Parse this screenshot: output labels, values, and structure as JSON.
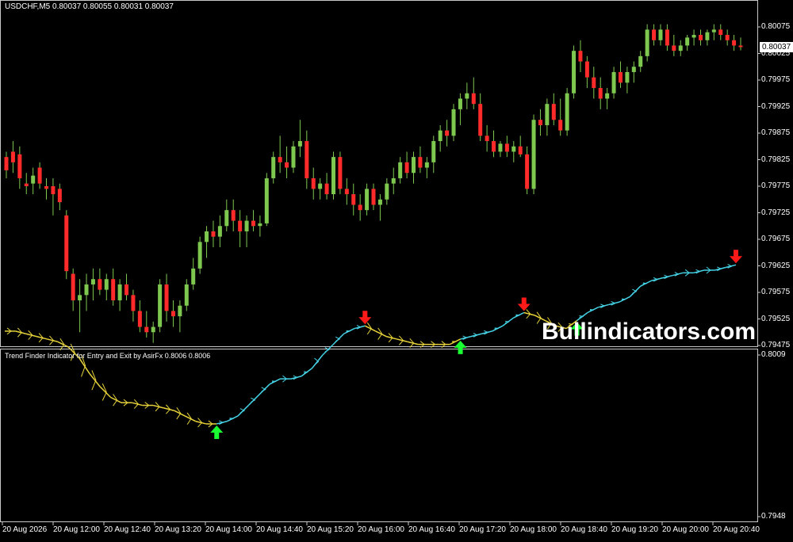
{
  "window": {
    "symbol_header": "USDCHF,M5  0.80037 0.80055 0.80031 0.80037",
    "indicator_header": "Trend Finder Indicator for Entry and Exit by AsirFx 0.8006 0.8006",
    "current_price": "0.80037",
    "watermark": "Bullindicators.com"
  },
  "colors": {
    "background": "#000000",
    "bull_candle": "#7ec850",
    "bear_candle": "#ff2a2a",
    "wick": "#7ec850",
    "uptrend": "#45d3e6",
    "downtrend": "#e6d23a",
    "buy_arrow": "#19ff32",
    "sell_arrow": "#ff1a1a"
  },
  "price_axis": [
    "0.80075",
    "0.80025",
    "0.79975",
    "0.79925",
    "0.79875",
    "0.79825",
    "0.79775",
    "0.79725",
    "0.79675",
    "0.79625",
    "0.79575",
    "0.79525",
    "0.79475"
  ],
  "indicator_axis": [
    "0.8009",
    "0.7948"
  ],
  "time_axis": [
    "20 Aug 2026",
    "20 Aug 12:00",
    "20 Aug 12:40",
    "20 Aug 13:20",
    "20 Aug 14:00",
    "20 Aug 14:40",
    "20 Aug 15:20",
    "20 Aug 16:00",
    "20 Aug 16:40",
    "20 Aug 17:20",
    "20 Aug 18:00",
    "20 Aug 18:40",
    "20 Aug 19:20",
    "20 Aug 20:00",
    "20 Aug 20:40"
  ],
  "chart_data": [
    {
      "type": "candlestick",
      "ylim": [
        0.79475,
        0.80075
      ],
      "candles": [
        [
          0.7983,
          0.7984,
          0.7979,
          0.79805
        ],
        [
          0.7984,
          0.7986,
          0.798,
          0.7982
        ],
        [
          0.79835,
          0.7985,
          0.7977,
          0.7979
        ],
        [
          0.7978,
          0.798,
          0.7976,
          0.79775
        ],
        [
          0.7978,
          0.7981,
          0.7976,
          0.79795
        ],
        [
          0.7981,
          0.7982,
          0.7977,
          0.7978
        ],
        [
          0.79775,
          0.7979,
          0.7975,
          0.7977
        ],
        [
          0.79775,
          0.7979,
          0.7972,
          0.7976
        ],
        [
          0.7977,
          0.7978,
          0.7973,
          0.79745
        ],
        [
          0.7972,
          0.7973,
          0.796,
          0.79615
        ],
        [
          0.7961,
          0.7962,
          0.7954,
          0.7956
        ],
        [
          0.7956,
          0.796,
          0.795,
          0.7957
        ],
        [
          0.7957,
          0.7961,
          0.7954,
          0.7959
        ],
        [
          0.7959,
          0.7962,
          0.7956,
          0.796
        ],
        [
          0.796,
          0.7962,
          0.7957,
          0.7958
        ],
        [
          0.7958,
          0.7961,
          0.7956,
          0.796
        ],
        [
          0.796,
          0.7962,
          0.7955,
          0.7956
        ],
        [
          0.7956,
          0.796,
          0.7954,
          0.7959
        ],
        [
          0.7959,
          0.7961,
          0.7956,
          0.7957
        ],
        [
          0.7957,
          0.7958,
          0.7952,
          0.7954
        ],
        [
          0.7954,
          0.7956,
          0.795,
          0.7951
        ],
        [
          0.7951,
          0.7954,
          0.7949,
          0.795
        ],
        [
          0.795,
          0.7952,
          0.7948,
          0.7951
        ],
        [
          0.7951,
          0.796,
          0.795,
          0.7959
        ],
        [
          0.7959,
          0.7961,
          0.7952,
          0.7954
        ],
        [
          0.7954,
          0.7956,
          0.7951,
          0.7953
        ],
        [
          0.7953,
          0.7956,
          0.795,
          0.7955
        ],
        [
          0.7955,
          0.796,
          0.7954,
          0.7959
        ],
        [
          0.7959,
          0.7964,
          0.7958,
          0.7962
        ],
        [
          0.7962,
          0.7968,
          0.7961,
          0.7967
        ],
        [
          0.7967,
          0.797,
          0.7964,
          0.7969
        ],
        [
          0.7969,
          0.7971,
          0.7966,
          0.7968
        ],
        [
          0.7968,
          0.7972,
          0.7966,
          0.797
        ],
        [
          0.797,
          0.7975,
          0.7969,
          0.7973
        ],
        [
          0.7973,
          0.7975,
          0.7969,
          0.7971
        ],
        [
          0.7971,
          0.7973,
          0.7966,
          0.7969
        ],
        [
          0.7969,
          0.7972,
          0.7966,
          0.7971
        ],
        [
          0.7971,
          0.7973,
          0.7969,
          0.797
        ],
        [
          0.797,
          0.7972,
          0.7968,
          0.79705
        ],
        [
          0.79705,
          0.798,
          0.797,
          0.7979
        ],
        [
          0.7979,
          0.7984,
          0.7978,
          0.7983
        ],
        [
          0.7983,
          0.7987,
          0.798,
          0.7982
        ],
        [
          0.7982,
          0.7985,
          0.7979,
          0.7981
        ],
        [
          0.7981,
          0.7986,
          0.798,
          0.7985
        ],
        [
          0.7985,
          0.799,
          0.7983,
          0.7986
        ],
        [
          0.7986,
          0.7988,
          0.7977,
          0.7979
        ],
        [
          0.7979,
          0.7981,
          0.7975,
          0.7977
        ],
        [
          0.7977,
          0.7979,
          0.7975,
          0.7978
        ],
        [
          0.7978,
          0.798,
          0.7975,
          0.7976
        ],
        [
          0.7976,
          0.7984,
          0.7975,
          0.7983
        ],
        [
          0.7983,
          0.7984,
          0.7976,
          0.7977
        ],
        [
          0.7977,
          0.7979,
          0.7974,
          0.7976
        ],
        [
          0.7976,
          0.7978,
          0.7972,
          0.7974
        ],
        [
          0.7974,
          0.7976,
          0.7971,
          0.7973
        ],
        [
          0.7973,
          0.7978,
          0.7972,
          0.7977
        ],
        [
          0.7977,
          0.7978,
          0.7973,
          0.7974
        ],
        [
          0.7974,
          0.7976,
          0.7971,
          0.7975
        ],
        [
          0.7975,
          0.7979,
          0.7974,
          0.7978
        ],
        [
          0.7978,
          0.7981,
          0.7976,
          0.7979
        ],
        [
          0.7979,
          0.7983,
          0.7978,
          0.7982
        ],
        [
          0.7982,
          0.7984,
          0.7979,
          0.798
        ],
        [
          0.798,
          0.7984,
          0.7978,
          0.7983
        ],
        [
          0.7983,
          0.7985,
          0.798,
          0.7981
        ],
        [
          0.7981,
          0.7983,
          0.7979,
          0.7982
        ],
        [
          0.7982,
          0.7987,
          0.798,
          0.7986
        ],
        [
          0.7986,
          0.7989,
          0.7984,
          0.7988
        ],
        [
          0.7988,
          0.799,
          0.7985,
          0.7987
        ],
        [
          0.7987,
          0.7993,
          0.7986,
          0.7992
        ],
        [
          0.7992,
          0.7995,
          0.7989,
          0.7994
        ],
        [
          0.7994,
          0.7997,
          0.7992,
          0.7995
        ],
        [
          0.7995,
          0.7998,
          0.7992,
          0.7993
        ],
        [
          0.7993,
          0.7995,
          0.7986,
          0.7987
        ],
        [
          0.7987,
          0.7989,
          0.7984,
          0.7986
        ],
        [
          0.7986,
          0.7988,
          0.7983,
          0.7984
        ],
        [
          0.7984,
          0.7986,
          0.7983,
          0.79855
        ],
        [
          0.79855,
          0.7987,
          0.7983,
          0.7984
        ],
        [
          0.7984,
          0.7986,
          0.7982,
          0.7985
        ],
        [
          0.7985,
          0.7987,
          0.7983,
          0.79835
        ],
        [
          0.79835,
          0.7985,
          0.7976,
          0.7977
        ],
        [
          0.7977,
          0.7991,
          0.7976,
          0.799
        ],
        [
          0.799,
          0.7992,
          0.7987,
          0.7989
        ],
        [
          0.7989,
          0.7994,
          0.7987,
          0.7993
        ],
        [
          0.7993,
          0.7995,
          0.7989,
          0.799
        ],
        [
          0.799,
          0.7994,
          0.7987,
          0.7988
        ],
        [
          0.7988,
          0.7996,
          0.7987,
          0.7995
        ],
        [
          0.7995,
          0.8004,
          0.7994,
          0.8003
        ],
        [
          0.8003,
          0.8005,
          0.7999,
          0.8001
        ],
        [
          0.8001,
          0.8002,
          0.7996,
          0.7998
        ],
        [
          0.7998,
          0.8,
          0.7994,
          0.7996
        ],
        [
          0.7996,
          0.7998,
          0.7992,
          0.7994
        ],
        [
          0.7994,
          0.7996,
          0.7992,
          0.7995
        ],
        [
          0.7995,
          0.8,
          0.7994,
          0.7999
        ],
        [
          0.7999,
          0.8001,
          0.7996,
          0.7997
        ],
        [
          0.7997,
          0.8,
          0.7995,
          0.7999
        ],
        [
          0.7999,
          0.8001,
          0.7997,
          0.8
        ],
        [
          0.8,
          0.8003,
          0.7999,
          0.8002
        ],
        [
          0.8002,
          0.8008,
          0.8001,
          0.8007
        ],
        [
          0.8007,
          0.8008,
          0.8004,
          0.8005
        ],
        [
          0.8005,
          0.8008,
          0.8004,
          0.8007
        ],
        [
          0.8007,
          0.8008,
          0.8003,
          0.8004
        ],
        [
          0.8004,
          0.8006,
          0.8002,
          0.8003
        ],
        [
          0.8003,
          0.8005,
          0.8002,
          0.8004
        ],
        [
          0.8004,
          0.8006,
          0.8003,
          0.80055
        ],
        [
          0.80055,
          0.8007,
          0.8004,
          0.8006
        ],
        [
          0.8006,
          0.8007,
          0.8004,
          0.8005
        ],
        [
          0.8005,
          0.8007,
          0.8004,
          0.80065
        ],
        [
          0.80065,
          0.8008,
          0.8005,
          0.8007
        ],
        [
          0.8007,
          0.8008,
          0.8005,
          0.8006
        ],
        [
          0.8006,
          0.8007,
          0.8004,
          0.8005
        ],
        [
          0.8005,
          0.8006,
          0.8003,
          0.8004
        ],
        [
          0.8004,
          0.80055,
          0.80031,
          0.80037
        ]
      ]
    },
    {
      "type": "line",
      "ylim": [
        0.7948,
        0.8009
      ],
      "values": [
        0.8018,
        0.8018,
        0.8017,
        0.8016,
        0.8015,
        0.8014,
        0.8012,
        0.8008,
        0.8002,
        0.7997,
        0.7993,
        0.7991,
        0.7991,
        0.799,
        0.799,
        0.7989,
        0.7988,
        0.7986,
        0.7984,
        0.7983,
        0.7983,
        0.7984,
        0.7986,
        0.799,
        0.7994,
        0.7998,
        0.8,
        0.8,
        0.8001,
        0.8004,
        0.8009,
        0.8013,
        0.8017,
        0.8019,
        0.802,
        0.8018,
        0.8016,
        0.8015,
        0.8014,
        0.8013,
        0.8013,
        0.8013,
        0.8013,
        0.8015,
        0.8016,
        0.8017,
        0.8018,
        0.802,
        0.8023,
        0.8025,
        0.8024,
        0.8022,
        0.802,
        0.8019,
        0.8022,
        0.8025,
        0.8027,
        0.8028,
        0.8029,
        0.8031,
        0.8035,
        0.8037,
        0.8038,
        0.8039,
        0.804,
        0.804,
        0.8041,
        0.8041,
        0.8042,
        0.8043
      ],
      "trend": [
        "down",
        "down",
        "down",
        "down",
        "down",
        "down",
        "down",
        "down",
        "down",
        "down",
        "down",
        "down",
        "down",
        "down",
        "down",
        "down",
        "down",
        "down",
        "down",
        "down",
        "up",
        "up",
        "up",
        "up",
        "up",
        "up",
        "up",
        "up",
        "up",
        "up",
        "up",
        "up",
        "up",
        "up",
        "down",
        "down",
        "down",
        "down",
        "down",
        "down",
        "down",
        "down",
        "down",
        "up",
        "up",
        "up",
        "up",
        "up",
        "up",
        "down",
        "down",
        "down",
        "down",
        "down",
        "up",
        "up",
        "up",
        "up",
        "up",
        "up",
        "up",
        "up",
        "up",
        "up",
        "up",
        "up",
        "up",
        "up",
        "up",
        "up"
      ],
      "signals": [
        {
          "type": "buy",
          "index": 20
        },
        {
          "type": "sell",
          "index": 34
        },
        {
          "type": "buy",
          "index": 43
        },
        {
          "type": "sell",
          "index": 49
        },
        {
          "type": "buy",
          "index": 54
        },
        {
          "type": "sell",
          "index": 69
        }
      ]
    }
  ]
}
